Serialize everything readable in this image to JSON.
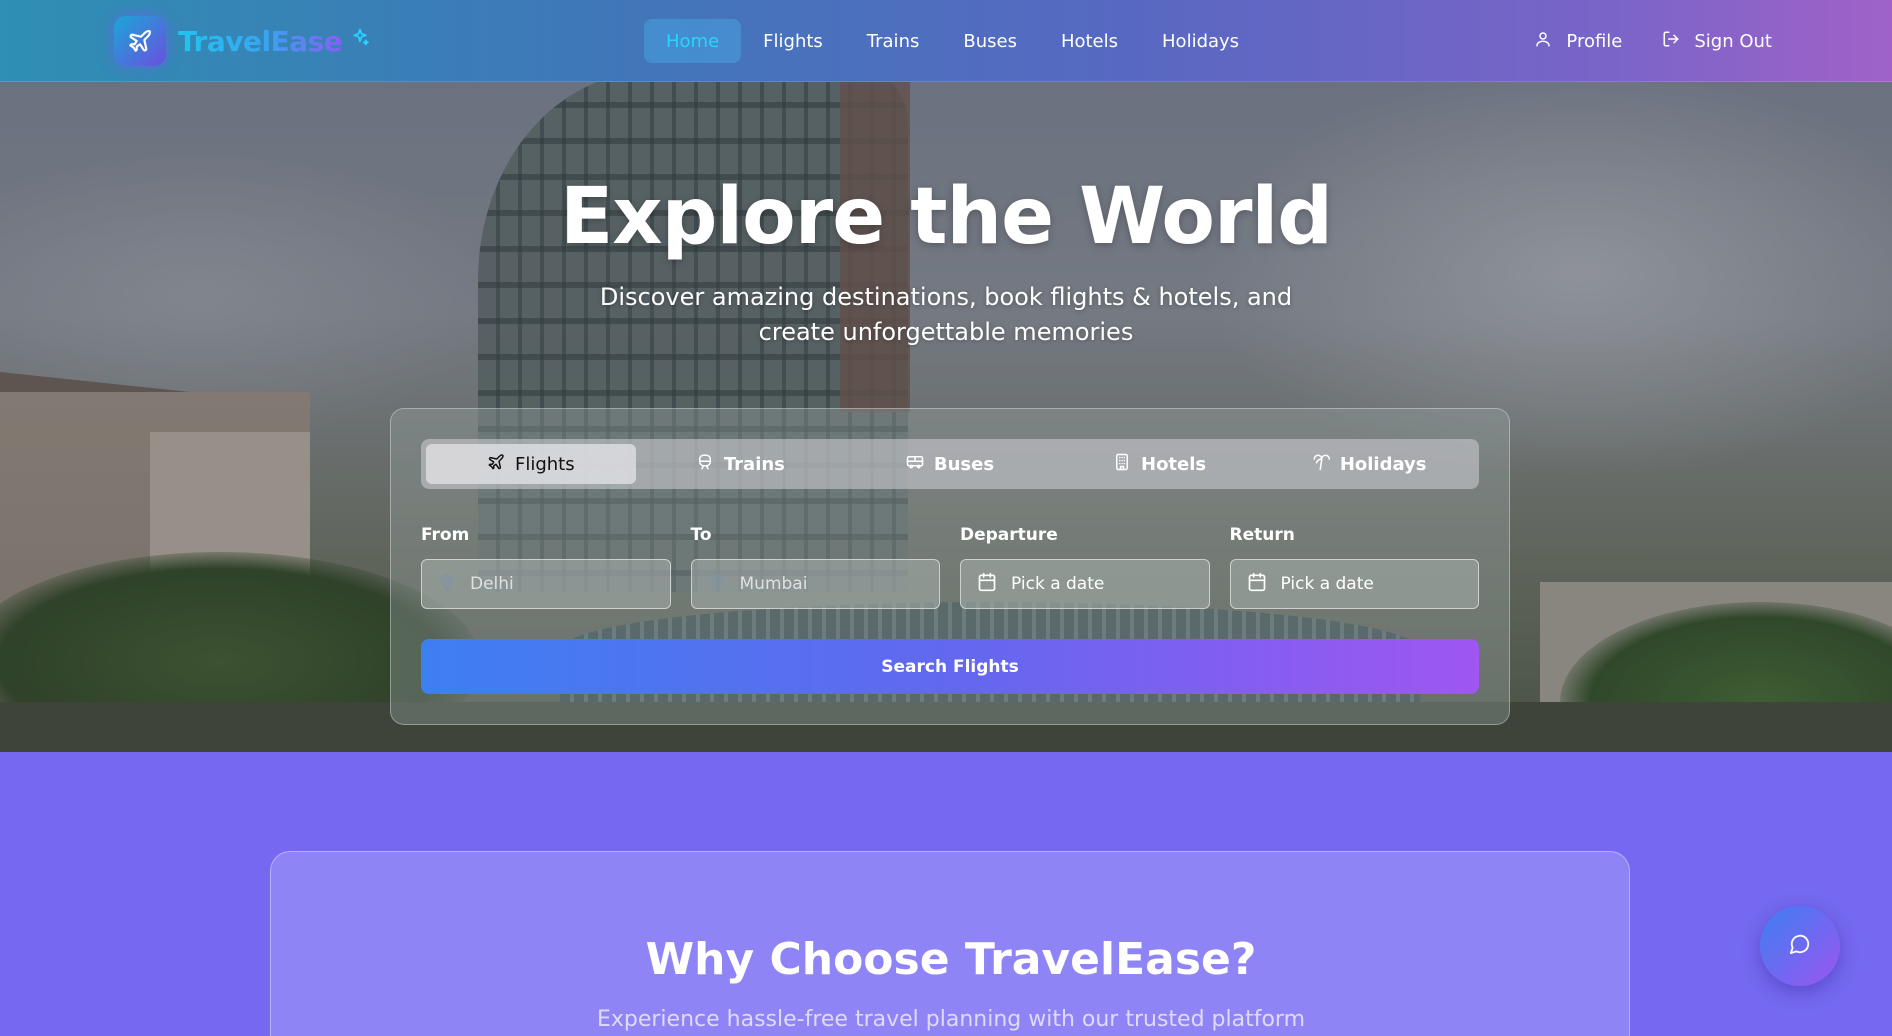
{
  "brand": {
    "name": "TravelEase"
  },
  "nav": {
    "links": [
      "Home",
      "Flights",
      "Trains",
      "Buses",
      "Hotels",
      "Holidays"
    ],
    "active": "Home",
    "profile_label": "Profile",
    "signout_label": "Sign Out"
  },
  "hero": {
    "title": "Explore the World",
    "subtitle": "Discover amazing destinations, book flights & hotels, and create unforgettable memories"
  },
  "search": {
    "tabs": [
      {
        "label": "Flights",
        "icon": "plane-icon"
      },
      {
        "label": "Trains",
        "icon": "train-icon"
      },
      {
        "label": "Buses",
        "icon": "bus-icon"
      },
      {
        "label": "Hotels",
        "icon": "hotel-icon"
      },
      {
        "label": "Holidays",
        "icon": "palm-tree-icon"
      }
    ],
    "active_tab": "Flights",
    "fields": {
      "from": {
        "label": "From",
        "placeholder": "Delhi"
      },
      "to": {
        "label": "To",
        "placeholder": "Mumbai"
      },
      "departure": {
        "label": "Departure",
        "value": "Pick a date"
      },
      "return": {
        "label": "Return",
        "value": "Pick a date"
      }
    },
    "button_label": "Search Flights"
  },
  "why": {
    "title": "Why Choose TravelEase?",
    "subtitle": "Experience hassle-free travel planning with our trusted platform"
  },
  "colors": {
    "accent_cyan": "#2ad3ff",
    "gradient_start": "#3e7ff2",
    "gradient_end": "#9f56f2",
    "lower_bg": "#7469f0"
  }
}
